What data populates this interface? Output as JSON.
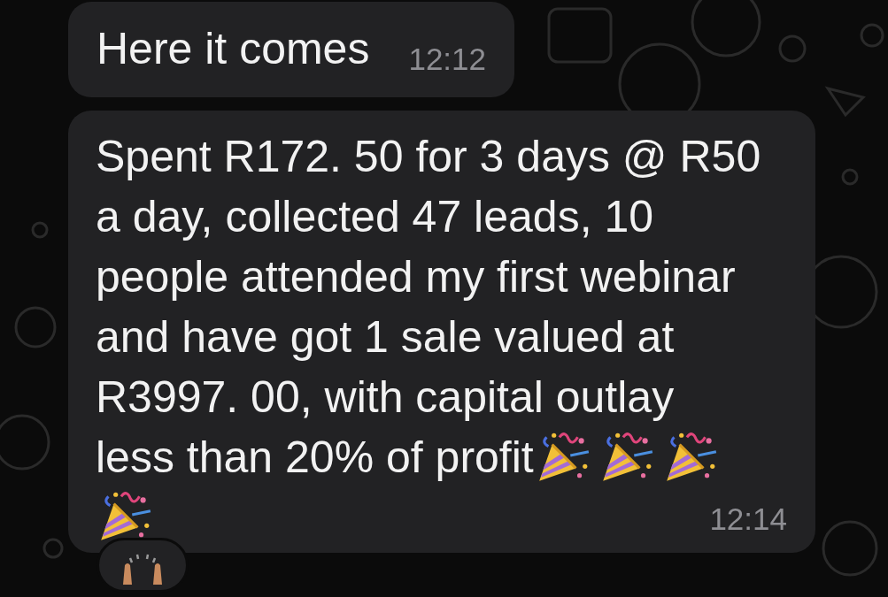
{
  "messages": [
    {
      "lines": [
        "Here it comes"
      ],
      "time": "12:12"
    },
    {
      "lines": [
        "Spent R172. 50 for 3 days @ R50",
        "a day, collected 47 leads, 10",
        "people attended my first webinar",
        "and have got 1 sale valued at",
        "R3997. 00, with capital outlay",
        "less than 20% of profit"
      ],
      "time": "12:14",
      "trailing_emoji": [
        {
          "kind": "party_popper"
        },
        {
          "kind": "party_popper"
        },
        {
          "kind": "party_popper"
        },
        {
          "kind": "party_popper"
        }
      ],
      "has_reaction": true
    }
  ]
}
